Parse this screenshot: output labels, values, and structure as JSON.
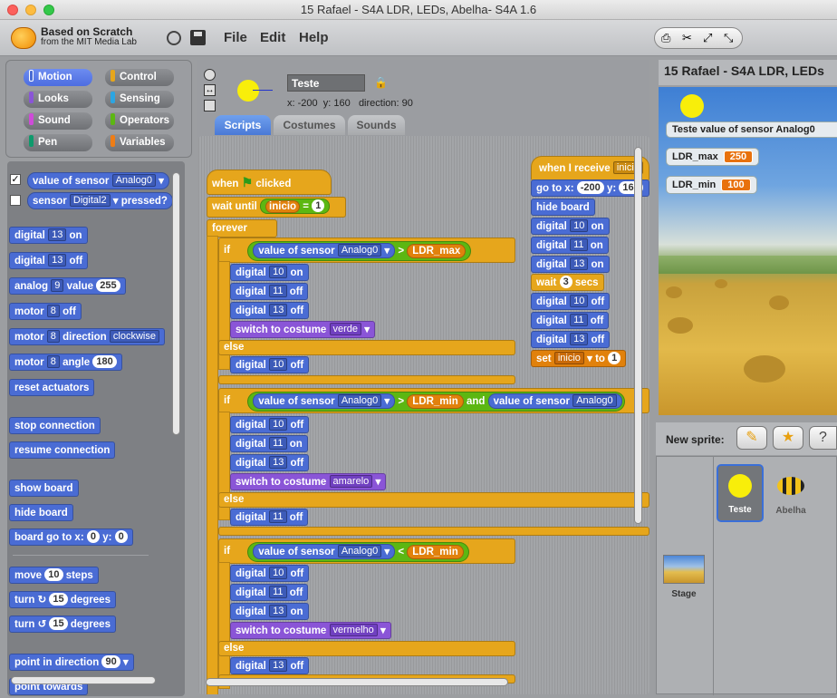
{
  "window": {
    "title": "15 Rafael - S4A LDR, LEDs, Abelha- S4A 1.6"
  },
  "logo": {
    "line1": "Based on Scratch",
    "line2": "from the MIT Media Lab"
  },
  "menu": {
    "file": "File",
    "edit": "Edit",
    "help": "Help"
  },
  "categories": [
    {
      "label": "Motion",
      "color": "#4a6cd4",
      "selected": true
    },
    {
      "label": "Control",
      "color": "#e6a61c"
    },
    {
      "label": "Looks",
      "color": "#8a55d7"
    },
    {
      "label": "Sensing",
      "color": "#2ca5e2"
    },
    {
      "label": "Sound",
      "color": "#cf4ad9"
    },
    {
      "label": "Operators",
      "color": "#5cb712"
    },
    {
      "label": "Pen",
      "color": "#0e9a6c"
    },
    {
      "label": "Variables",
      "color": "#ee7d16"
    }
  ],
  "palette": {
    "value_of_sensor": "value of sensor",
    "analog0": "Analog0",
    "sensor": "sensor",
    "digital2": "Digital2",
    "pressed": "pressed?",
    "digital": "digital",
    "analog": "analog",
    "on": "on",
    "off": "off",
    "value": "value",
    "motor": "motor",
    "direction": "direction",
    "angle": "angle",
    "clockwise": "clockwise",
    "n13": "13",
    "n9": "9",
    "n8": "8",
    "v255": "255",
    "v180": "180",
    "reset_actuators": "reset actuators",
    "stop_connection": "stop connection",
    "resume_connection": "resume connection",
    "show_board": "show board",
    "hide_board": "hide board",
    "board_go_to": "board go to x:",
    "y": "y:",
    "zero": "0",
    "move": "move",
    "steps": "steps",
    "n10": "10",
    "turn": "turn",
    "degrees": "degrees",
    "n15": "15",
    "point_in_direction": "point in direction",
    "n90": "90",
    "point_towards": "point towards"
  },
  "sprite": {
    "name": "Teste",
    "x_label": "x:",
    "x": "-200",
    "y_label": "y:",
    "y": "160",
    "direction_label": "direction:",
    "direction": "90"
  },
  "tabs": {
    "scripts": "Scripts",
    "costumes": "Costumes",
    "sounds": "Sounds"
  },
  "script": {
    "when": "when",
    "clicked": "clicked",
    "wait_until": "wait until",
    "inicio": "inicio",
    "eq": "=",
    "one": "1",
    "forever": "forever",
    "if": "if",
    "else": "else",
    "value_of_sensor": "value of sensor",
    "analog0": "Analog0",
    "gt": ">",
    "lt": "<",
    "ldr_max": "LDR_max",
    "ldr_min": "LDR_min",
    "and": "and",
    "digital": "digital",
    "on": "on",
    "off": "off",
    "n10": "10",
    "n11": "11",
    "n13": "13",
    "switch_to_costume": "switch to costume",
    "verde": "verde",
    "amarelo": "amarelo",
    "vermelho": "vermelho",
    "when_i_receive": "when I receive",
    "inicio_msg": "inicio",
    "go_to_x": "go to x:",
    "neg200": "-200",
    "y": "y:",
    "y160": "160",
    "hide_board": "hide board",
    "wait": "wait",
    "three": "3",
    "secs": "secs",
    "set": "set",
    "to": "to"
  },
  "stage": {
    "title": "15 Rafael - S4A LDR, LEDs",
    "watch_sensor": "Teste value of sensor Analog0",
    "watch_max_label": "LDR_max",
    "watch_max_value": "250",
    "watch_min_label": "LDR_min",
    "watch_min_value": "100"
  },
  "sprites_pane": {
    "new_sprite": "New sprite:",
    "sprites": [
      {
        "name": "Teste",
        "selected": true
      },
      {
        "name": "Abelha"
      }
    ],
    "stage_label": "Stage"
  }
}
